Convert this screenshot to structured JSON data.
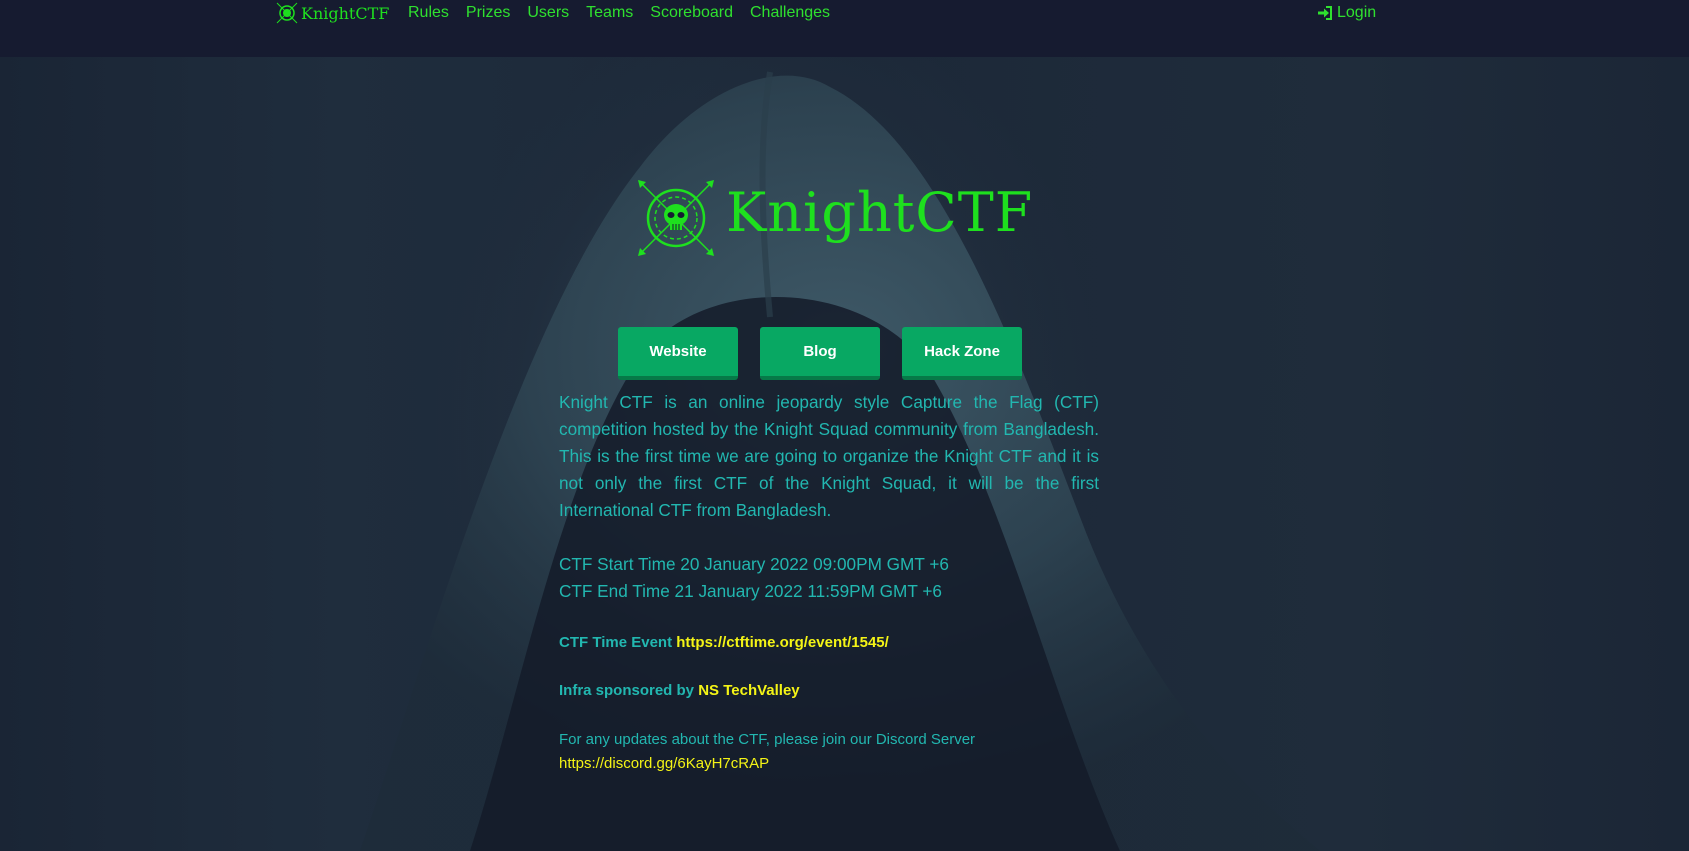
{
  "navbar": {
    "brand": "KnightCTF",
    "links": [
      "Rules",
      "Prizes",
      "Users",
      "Teams",
      "Scoreboard",
      "Challenges"
    ],
    "login": "Login"
  },
  "hero": {
    "title": "KnightCTF"
  },
  "buttons": [
    "Website",
    "Blog",
    "Hack Zone"
  ],
  "content": {
    "description": "Knight CTF is an online jeopardy style Capture the Flag (CTF) competition hosted by the Knight Squad community from Bangladesh. This is the first time we are going to organize the Knight CTF and it is not only the first CTF of the Knight Squad, it will be the first International CTF from Bangladesh.",
    "start_time": "CTF Start Time 20 January 2022 09:00PM GMT +6",
    "end_time": "CTF End Time 21 January 2022 11:59PM GMT +6",
    "event_label": "CTF Time Event",
    "event_link": "https://ctftime.org/event/1545/",
    "sponsor_label": "Infra sponsored by",
    "sponsor_name": "NS TechValley",
    "discord_text": "For any updates about the CTF, please join our Discord Server",
    "discord_link": "https://discord.gg/6KayH7cRAP"
  },
  "colors": {
    "accent_green": "#1ee01e",
    "button_green": "#08a863",
    "text_teal": "#22b7b0",
    "link_yellow": "#f4f416",
    "background": "#161c31"
  },
  "icons": [
    "skull-emblem-icon",
    "sign-in-icon"
  ]
}
